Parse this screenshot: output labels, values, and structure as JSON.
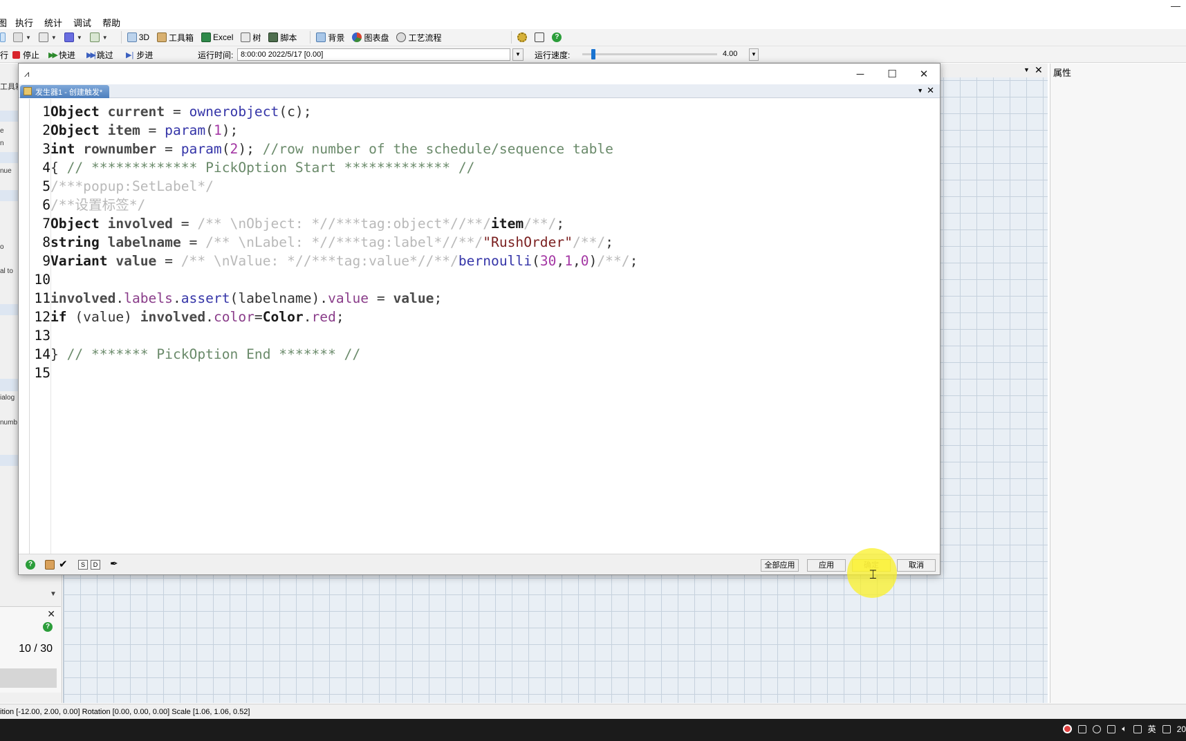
{
  "menu": {
    "items": [
      "图",
      "执行",
      "统计",
      "调试",
      "帮助"
    ]
  },
  "toolbar": {
    "btn_3d": "3D",
    "btn_toolbox": "工具箱",
    "btn_excel": "Excel",
    "btn_tree": "树",
    "btn_script": "脚本",
    "btn_background": "背景",
    "btn_dashboard": "图表盘",
    "btn_process_flow": "工艺流程"
  },
  "runbar": {
    "reset_label": "行",
    "stop_label": "停止",
    "fast_label": "快进",
    "skip_label": "跳过",
    "step_label": "步进",
    "runtime_label": "运行时间:",
    "runtime_value": "8:00:00  2022/5/17  [0.00]",
    "speed_label": "运行速度:",
    "speed_value": "4.00"
  },
  "left_panel": {
    "header": "工具箱",
    "rows": [
      "e",
      "n",
      "nue",
      "o",
      "al to",
      "ialog",
      "numb"
    ],
    "count_text": "10 / 30"
  },
  "right_panel": {
    "title": "属性"
  },
  "dialog": {
    "tab_title": "发生器1 - 创建触发*",
    "code_lines": [
      {
        "n": "1",
        "parts": [
          [
            "kw",
            "Object"
          ],
          [
            "op",
            " "
          ],
          [
            "id",
            "current"
          ],
          [
            "op",
            " = "
          ],
          [
            "fn",
            "ownerobject"
          ],
          [
            "op",
            "(c);"
          ]
        ]
      },
      {
        "n": "2",
        "parts": [
          [
            "kw",
            "Object"
          ],
          [
            "op",
            " "
          ],
          [
            "id",
            "item"
          ],
          [
            "op",
            " = "
          ],
          [
            "fn",
            "param"
          ],
          [
            "op",
            "("
          ],
          [
            "num",
            "1"
          ],
          [
            "op",
            ");"
          ]
        ]
      },
      {
        "n": "3",
        "parts": [
          [
            "kw",
            "int"
          ],
          [
            "op",
            " "
          ],
          [
            "id",
            "rownumber"
          ],
          [
            "op",
            " = "
          ],
          [
            "fn",
            "param"
          ],
          [
            "op",
            "("
          ],
          [
            "num",
            "2"
          ],
          [
            "op",
            "); "
          ],
          [
            "cm",
            "//row number of the schedule/sequence table"
          ]
        ]
      },
      {
        "n": "4",
        "parts": [
          [
            "op",
            "{ "
          ],
          [
            "cm",
            "// ************* PickOption Start ************* //"
          ]
        ]
      },
      {
        "n": "5",
        "parts": [
          [
            "gc",
            "/***popup:SetLabel*/"
          ]
        ]
      },
      {
        "n": "6",
        "parts": [
          [
            "gc",
            "/**设置标签*/"
          ]
        ]
      },
      {
        "n": "7",
        "parts": [
          [
            "kw",
            "Object"
          ],
          [
            "op",
            " "
          ],
          [
            "id",
            "involved"
          ],
          [
            "op",
            " = "
          ],
          [
            "gc",
            "/** \\nObject: *//***tag:object*//**/"
          ],
          [
            "cls",
            "item"
          ],
          [
            "gc",
            "/**/"
          ],
          [
            "op",
            ";"
          ]
        ]
      },
      {
        "n": "8",
        "parts": [
          [
            "kw",
            "string"
          ],
          [
            "op",
            " "
          ],
          [
            "id",
            "labelname"
          ],
          [
            "op",
            " = "
          ],
          [
            "gc",
            "/** \\nLabel: *//***tag:label*//**/"
          ],
          [
            "str",
            "\"RushOrder\""
          ],
          [
            "gc",
            "/**/"
          ],
          [
            "op",
            ";"
          ]
        ]
      },
      {
        "n": "9",
        "parts": [
          [
            "kw",
            "Variant"
          ],
          [
            "op",
            " "
          ],
          [
            "id",
            "value"
          ],
          [
            "op",
            " = "
          ],
          [
            "gc",
            "/** \\nValue: *//***tag:value*//**/"
          ],
          [
            "fn",
            "bernoulli"
          ],
          [
            "op",
            "("
          ],
          [
            "num",
            "30"
          ],
          [
            "op",
            ","
          ],
          [
            "num",
            "1"
          ],
          [
            "op",
            ","
          ],
          [
            "num",
            "0"
          ],
          [
            "op",
            ")"
          ],
          [
            "gc",
            "/**/"
          ],
          [
            "op",
            ";"
          ]
        ]
      },
      {
        "n": "10",
        "parts": []
      },
      {
        "n": "11",
        "parts": [
          [
            "id",
            "involved"
          ],
          [
            "op",
            "."
          ],
          [
            "prop",
            "labels"
          ],
          [
            "op",
            "."
          ],
          [
            "fn",
            "assert"
          ],
          [
            "op",
            "(labelname)."
          ],
          [
            "prop",
            "value"
          ],
          [
            "op",
            " = "
          ],
          [
            "id",
            "value"
          ],
          [
            "op",
            ";"
          ]
        ]
      },
      {
        "n": "12",
        "parts": [
          [
            "kw",
            "if"
          ],
          [
            "op",
            " (value) "
          ],
          [
            "id",
            "involved"
          ],
          [
            "op",
            "."
          ],
          [
            "prop",
            "color"
          ],
          [
            "op",
            "="
          ],
          [
            "cls",
            "Color"
          ],
          [
            "op",
            "."
          ],
          [
            "prop",
            "red"
          ],
          [
            "op",
            ";"
          ]
        ]
      },
      {
        "n": "13",
        "parts": []
      },
      {
        "n": "14",
        "parts": [
          [
            "op",
            "} "
          ],
          [
            "cm",
            "// ******* PickOption End ******* //"
          ]
        ]
      },
      {
        "n": "15",
        "parts": []
      }
    ],
    "bottom": {
      "s_label": "S",
      "d_label": "D",
      "apply_all": "全部应用",
      "apply": "应用",
      "ok": "确定",
      "cancel": "取消"
    }
  },
  "statusbar": {
    "text": "ition [-12.00, 2.00, 0.00]  Rotation [0.00, 0.00, 0.00]  Scale [1.06, 1.06, 0.52]"
  },
  "taskbar": {
    "ime": "英",
    "clock_partial": "20"
  },
  "colors": {
    "accent": "#1a74d1",
    "tab_blue": "#4d7fbd",
    "help_green": "#2b9d3a",
    "highlight_yellow": "#faf028"
  }
}
